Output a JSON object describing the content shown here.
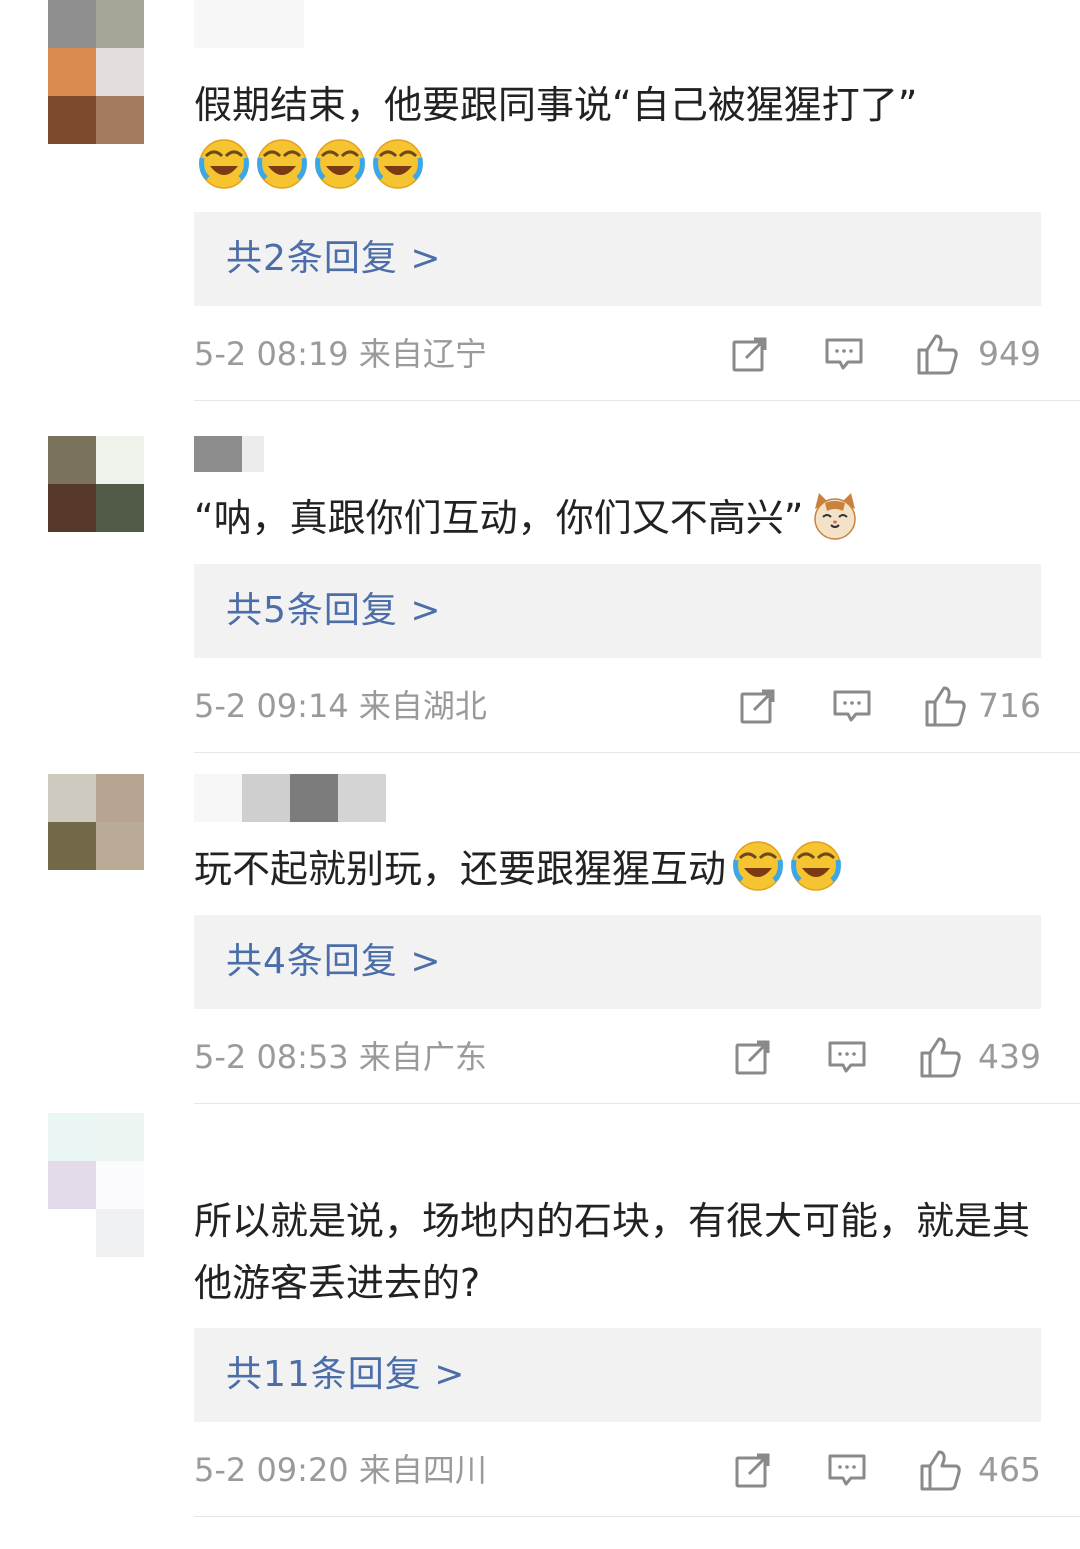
{
  "comments": [
    {
      "text": "假期结束，他要跟同事说“自己被猩猩打了”",
      "emojis": [
        "laugh-cry",
        "laugh-cry",
        "laugh-cry",
        "laugh-cry"
      ],
      "reply_label": "共2条回复 >",
      "time": "5-2 08:19 来自辽宁",
      "likes": "949"
    },
    {
      "text": "“呐，真跟你们互动，你们又不高兴”",
      "emojis": [
        "cat-face"
      ],
      "reply_label": "共5条回复 >",
      "time": "5-2 09:14 来自湖北",
      "likes": "716"
    },
    {
      "text": "玩不起就别玩，还要跟猩猩互动",
      "emojis": [
        "laugh-cry",
        "laugh-cry"
      ],
      "reply_label": "共4条回复 >",
      "time": "5-2 08:53 来自广东",
      "likes": "439"
    },
    {
      "text": "所以就是说，场地内的石块，有很大可能，就是其他游客丢进去的?",
      "emojis": [],
      "reply_label": "共11条回复 >",
      "time": "5-2 09:20 来自四川",
      "likes": "465"
    }
  ],
  "colors": {
    "reply_text": "#4c6ea8",
    "reply_bg": "#f2f2f2",
    "meta_text": "#9a9a9a",
    "body_text": "#222222"
  },
  "icons": [
    "share-icon",
    "comment-icon",
    "thumbs-up-icon",
    "laugh-cry-emoji",
    "cat-face-emoji"
  ]
}
